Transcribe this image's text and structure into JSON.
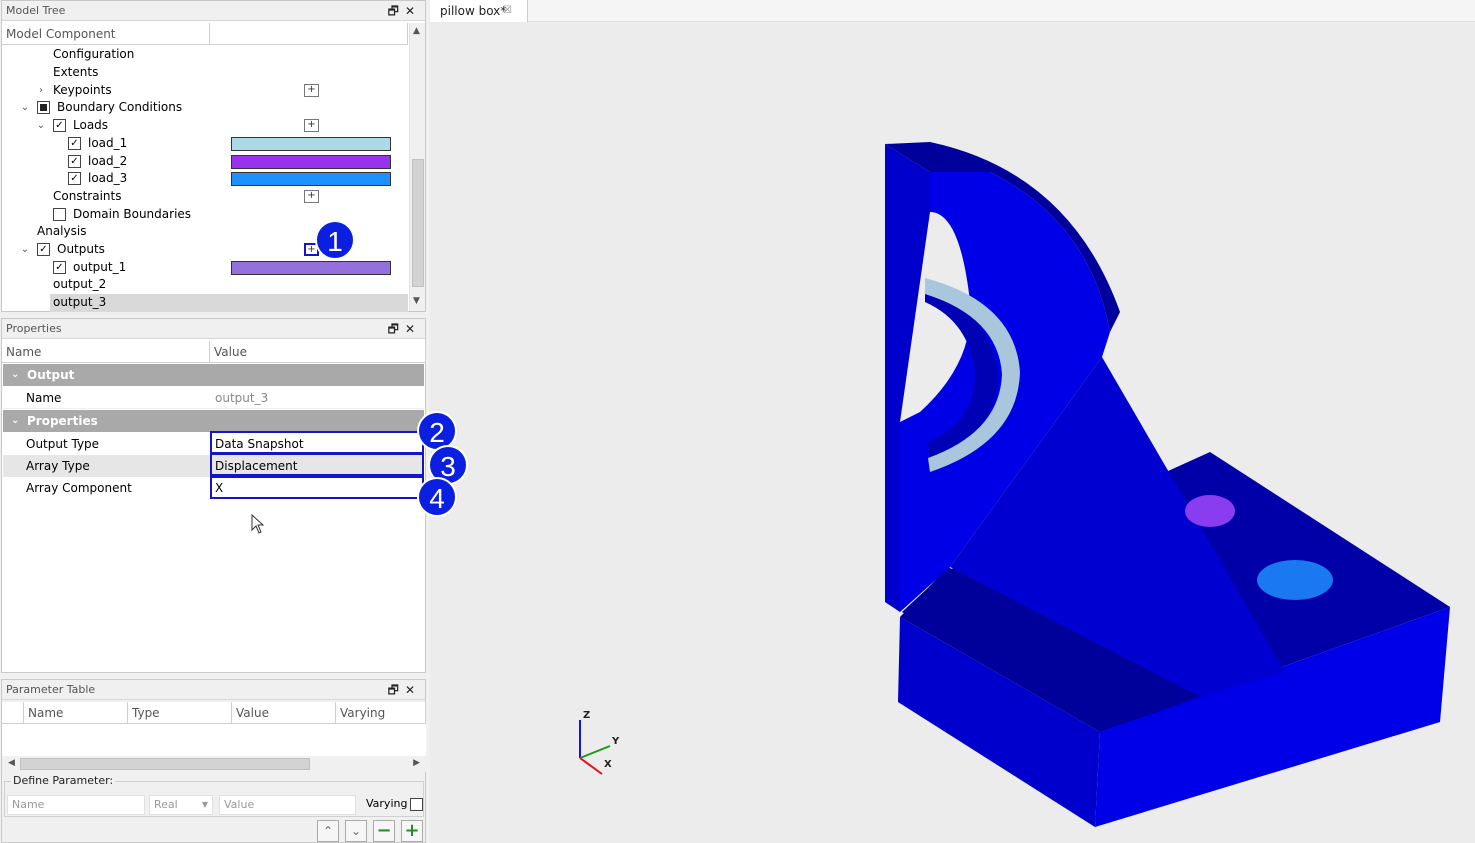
{
  "model_tree": {
    "title": "Model Tree",
    "column_component": "Model Component",
    "rows": [
      {
        "label": "Configuration"
      },
      {
        "label": "Extents"
      },
      {
        "label": "Keypoints"
      },
      {
        "label": "Boundary Conditions"
      },
      {
        "label": "Loads"
      },
      {
        "label": "load_1",
        "color": "#add8e6"
      },
      {
        "label": "load_2",
        "color": "#9932f0"
      },
      {
        "label": "load_3",
        "color": "#1e90ff"
      },
      {
        "label": "Constraints"
      },
      {
        "label": "Domain Boundaries"
      },
      {
        "label": "Analysis"
      },
      {
        "label": "Outputs"
      },
      {
        "label": "output_1",
        "color": "#9370db"
      },
      {
        "label": "output_2"
      },
      {
        "label": "output_3"
      }
    ]
  },
  "properties": {
    "title": "Properties",
    "col_name": "Name",
    "col_value": "Value",
    "group_output": "Output",
    "name_label": "Name",
    "name_value": "output_3",
    "group_properties": "Properties",
    "output_type_label": "Output Type",
    "output_type_value": "Data Snapshot",
    "array_type_label": "Array Type",
    "array_type_value": "Displacement",
    "array_component_label": "Array Component",
    "array_component_value": "X"
  },
  "parameter_table": {
    "title": "Parameter Table",
    "columns": [
      "Name",
      "Type",
      "Value",
      "Varying"
    ],
    "define_label": "Define Parameter:",
    "name_placeholder": "Name",
    "type_value": "Real",
    "value_placeholder": "Value",
    "varying_label": "Varying"
  },
  "viewport": {
    "tab_label": "pillow box*",
    "axis_z": "Z",
    "axis_y": "Y",
    "axis_x": "X"
  },
  "annotations": [
    "1",
    "2",
    "3",
    "4"
  ],
  "colors": {
    "highlight": "#1414c8",
    "badge": "#0a1fe0",
    "model_blue": "#0000e6"
  }
}
